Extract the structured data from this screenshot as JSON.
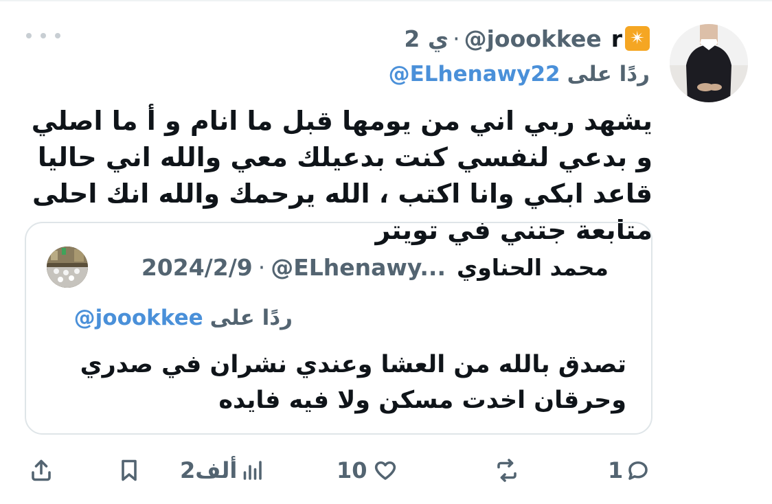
{
  "tweet": {
    "author": {
      "name": "r",
      "handle": "@joookkee",
      "badge_icon": "sparkle-icon"
    },
    "time": "2 ي",
    "separator": "·",
    "replying_label": "ردًا على",
    "replying_to": "@ELhenawy22",
    "text": "يشهد ربي اني من يومها قبل ما انام و أ ما اصلي و بدعي لنفسي كنت بدعيلك معي والله اني حاليا قاعد ابكي وانا اكتب ، الله يرحمك والله انك احلى متابعة جتني في تويتر"
  },
  "quote": {
    "author": {
      "name": "محمد الحناوي",
      "handle": "@ELhenawy..."
    },
    "date": "2024/2/9",
    "separator": "·",
    "replying_label": "ردًا على",
    "replying_to": "@joookkee",
    "text": "تصدق بالله من العشا وعندي نشران في صدري وحرقان اخدت مسكن ولا فيه فايده"
  },
  "actions": {
    "reply_count": "1",
    "retweet_count": "",
    "like_count": "10",
    "views_count": "2ألف",
    "icons": [
      "share-icon",
      "bookmark-icon",
      "views-icon",
      "like-icon",
      "retweet-icon",
      "reply-icon"
    ]
  },
  "colors": {
    "accent": "#4a90d9",
    "muted": "#536471",
    "text": "#0f1419",
    "border": "#dfe5e8"
  }
}
